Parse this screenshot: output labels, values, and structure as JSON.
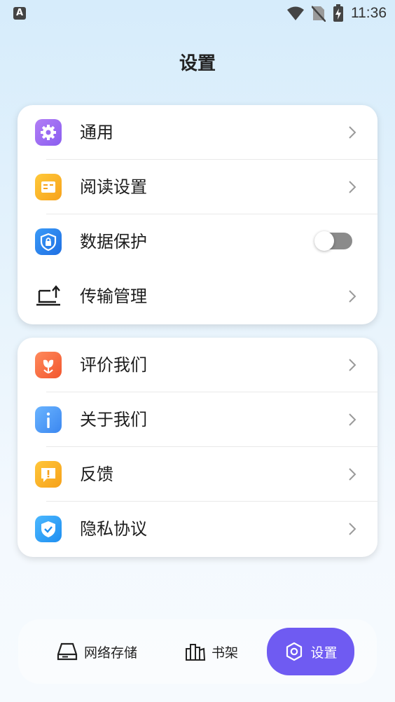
{
  "status_bar": {
    "time": "11:36",
    "app_indicator": "A"
  },
  "header": {
    "title": "设置"
  },
  "group1": [
    {
      "label": "通用",
      "icon": "gear-icon",
      "control": "chevron"
    },
    {
      "label": "阅读设置",
      "icon": "book-icon",
      "control": "chevron"
    },
    {
      "label": "数据保护",
      "icon": "shield-lock-icon",
      "control": "toggle",
      "toggle_on": false
    },
    {
      "label": "传输管理",
      "icon": "upload-laptop-icon",
      "control": "chevron"
    }
  ],
  "group2": [
    {
      "label": "评价我们",
      "icon": "flower-icon",
      "control": "chevron"
    },
    {
      "label": "关于我们",
      "icon": "info-icon",
      "control": "chevron"
    },
    {
      "label": "反馈",
      "icon": "feedback-icon",
      "control": "chevron"
    },
    {
      "label": "隐私协议",
      "icon": "privacy-shield-icon",
      "control": "chevron"
    }
  ],
  "nav": {
    "items": [
      {
        "label": "网络存储",
        "icon": "storage-icon",
        "active": false
      },
      {
        "label": "书架",
        "icon": "bookshelf-icon",
        "active": false
      },
      {
        "label": "设置",
        "icon": "settings-icon",
        "active": true
      }
    ]
  },
  "colors": {
    "accent": "#6f5bf2",
    "toggle_off": "#8b8b8b"
  }
}
